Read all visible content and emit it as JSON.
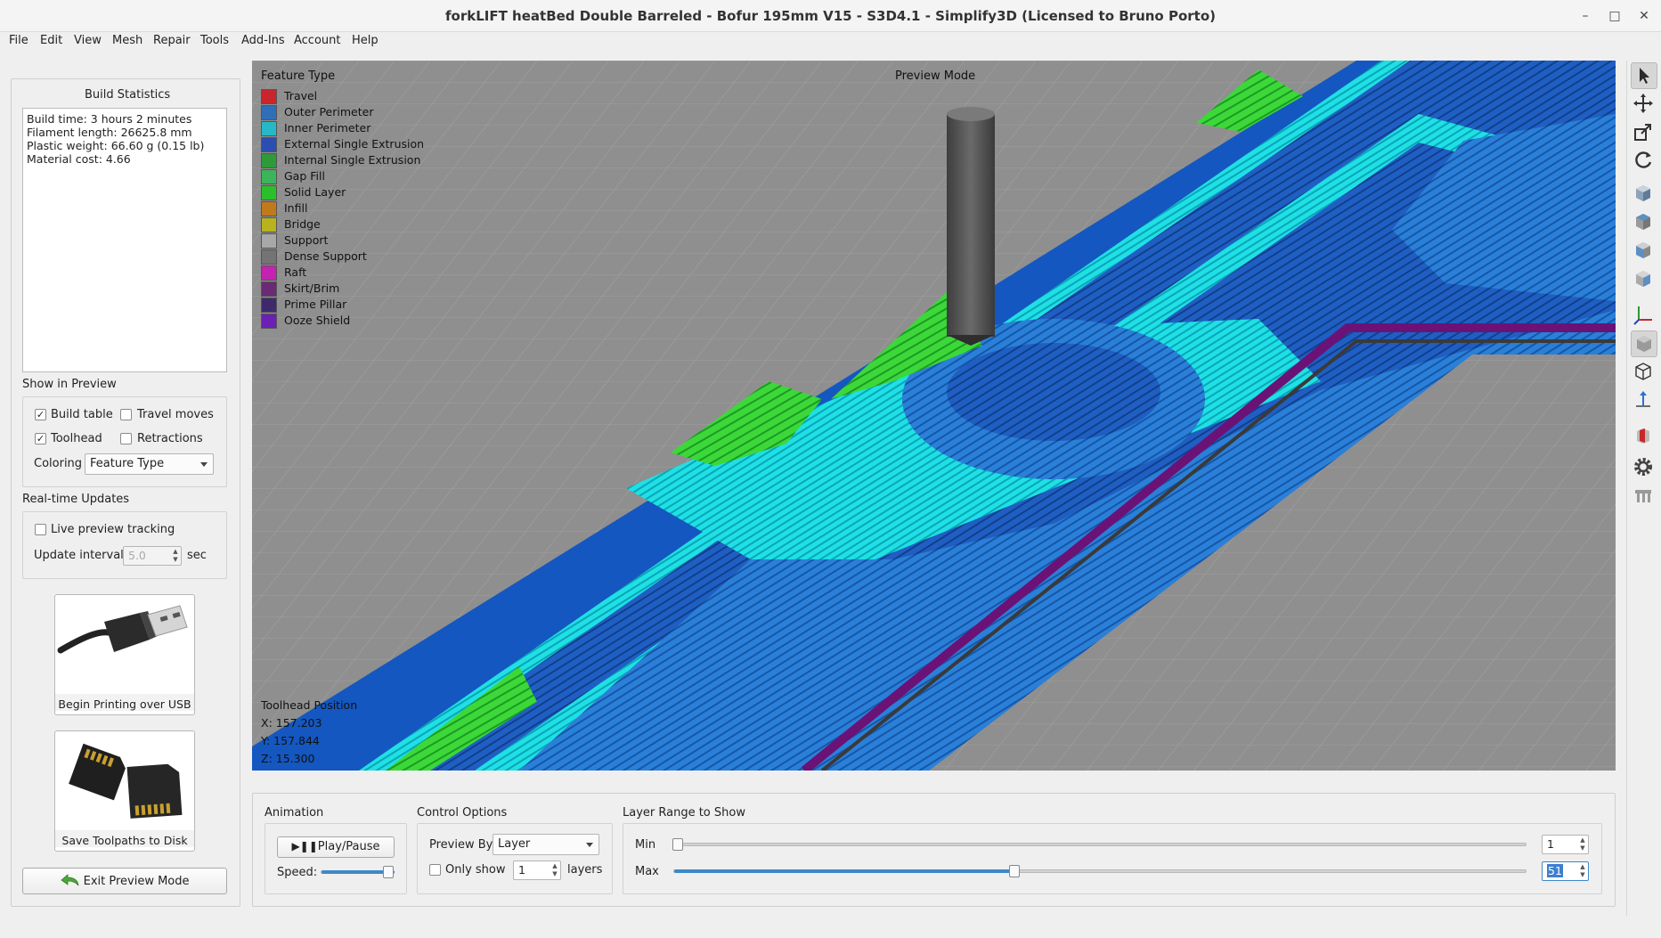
{
  "window": {
    "title": "forkLIFT heatBed Double Barreled - Bofur 195mm V15 - S3D4.1 - Simplify3D (Licensed to Bruno Porto)",
    "min_glyph": "–",
    "max_glyph": "□",
    "close_glyph": "✕"
  },
  "menu": [
    "File",
    "Edit",
    "View",
    "Mesh",
    "Repair",
    "Tools",
    "Add-Ins",
    "Account",
    "Help"
  ],
  "build_statistics": {
    "heading": "Build Statistics",
    "lines": [
      "Build time: 3 hours 2 minutes",
      "Filament length: 26625.8 mm",
      "Plastic weight: 66.60 g (0.15 lb)",
      "Material cost: 4.66"
    ]
  },
  "show_in_preview": {
    "heading": "Show in Preview",
    "build_table": {
      "label": "Build table",
      "checked": true
    },
    "travel_moves": {
      "label": "Travel moves",
      "checked": false
    },
    "toolhead": {
      "label": "Toolhead",
      "checked": true
    },
    "retractions": {
      "label": "Retractions",
      "checked": false
    },
    "coloring_label": "Coloring",
    "coloring_value": "Feature Type"
  },
  "realtime_updates": {
    "heading": "Real-time Updates",
    "live_tracking": {
      "label": "Live preview tracking",
      "checked": false
    },
    "interval_label": "Update interval",
    "interval_value": "5.0",
    "interval_unit": "sec"
  },
  "actions": {
    "usb_label": "Begin Printing over USB",
    "sd_label": "Save Toolpaths to Disk",
    "exit_label": "Exit Preview Mode"
  },
  "viewport": {
    "legend_title": "Feature Type",
    "mode_label": "Preview Mode",
    "legend": [
      {
        "label": "Travel",
        "color": "#c8262c"
      },
      {
        "label": "Outer Perimeter",
        "color": "#2f6fb8"
      },
      {
        "label": "Inner Perimeter",
        "color": "#27b8c8"
      },
      {
        "label": "External Single Extrusion",
        "color": "#2a4fb0"
      },
      {
        "label": "Internal Single Extrusion",
        "color": "#2e9a3a"
      },
      {
        "label": "Gap Fill",
        "color": "#3cb45a"
      },
      {
        "label": "Solid Layer",
        "color": "#2cbf2c"
      },
      {
        "label": "Infill",
        "color": "#c07a1c"
      },
      {
        "label": "Bridge",
        "color": "#b8b21e"
      },
      {
        "label": "Support",
        "color": "#a8a8a8"
      },
      {
        "label": "Dense Support",
        "color": "#747474"
      },
      {
        "label": "Raft",
        "color": "#c323b0"
      },
      {
        "label": "Skirt/Brim",
        "color": "#6a2a74"
      },
      {
        "label": "Prime Pillar",
        "color": "#3e2a6a"
      },
      {
        "label": "Ooze Shield",
        "color": "#6c1fb4"
      }
    ],
    "toolhead_title": "Toolhead Position",
    "x": "X: 157.203",
    "y": "Y: 157.844",
    "z": "Z: 15.300"
  },
  "animation": {
    "heading": "Animation",
    "play_label": "Play/Pause",
    "speed_label": "Speed:",
    "speed_level": 1.0
  },
  "control_options": {
    "heading": "Control Options",
    "preview_by_label": "Preview By",
    "preview_by_value": "Layer",
    "only_show": {
      "label": "Only show",
      "checked": false
    },
    "only_show_value": "1",
    "layers_label": "layers"
  },
  "layer_range": {
    "heading": "Layer Range to Show",
    "min_label": "Min",
    "min_value": "1",
    "max_label": "Max",
    "max_value": "51",
    "max_slider_level": 0.4
  },
  "right_toolbar": [
    "select-arrow-icon",
    "move-icon",
    "scale-icon",
    "rotate-icon",
    "front-view-cube-icon",
    "top-view-cube-icon",
    "left-view-cube-icon",
    "right-view-cube-icon",
    "axes-icon",
    "solid-view-icon",
    "wireframe-view-icon",
    "normal-icon",
    "section-view-icon",
    "settings-gear-icon",
    "bed-icon"
  ]
}
